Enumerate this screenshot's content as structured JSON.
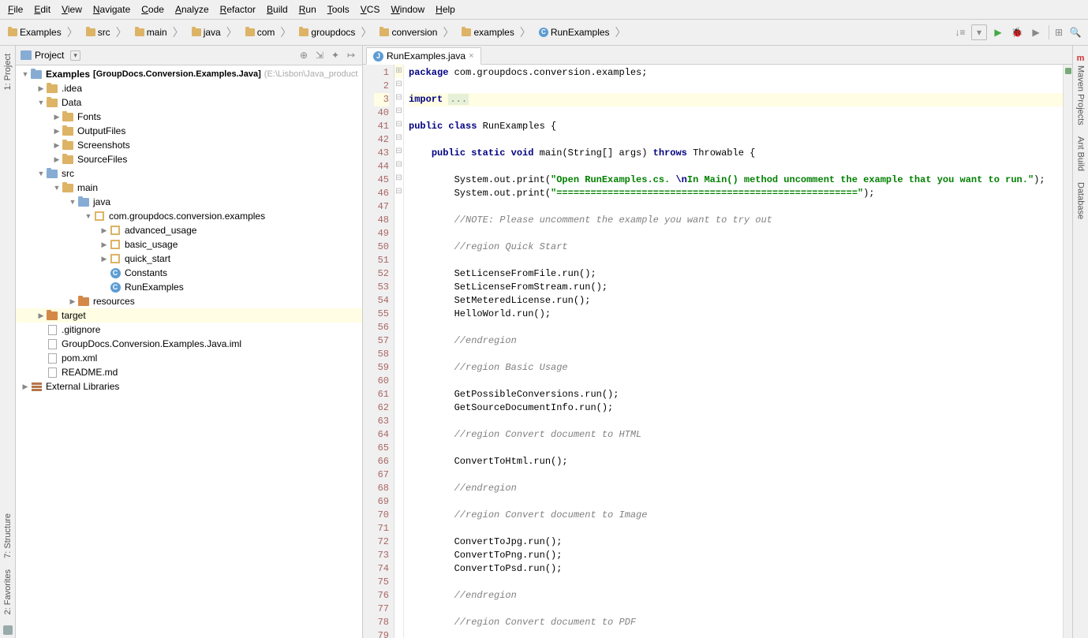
{
  "menu": [
    "File",
    "Edit",
    "View",
    "Navigate",
    "Code",
    "Analyze",
    "Refactor",
    "Build",
    "Run",
    "Tools",
    "VCS",
    "Window",
    "Help"
  ],
  "breadcrumbs": [
    {
      "icon": "folder",
      "label": "Examples"
    },
    {
      "icon": "folder",
      "label": "src"
    },
    {
      "icon": "folder",
      "label": "main"
    },
    {
      "icon": "folder",
      "label": "java"
    },
    {
      "icon": "folder",
      "label": "com"
    },
    {
      "icon": "folder",
      "label": "groupdocs"
    },
    {
      "icon": "folder",
      "label": "conversion"
    },
    {
      "icon": "folder",
      "label": "examples"
    },
    {
      "icon": "class",
      "label": "RunExamples"
    }
  ],
  "left_rail": [
    {
      "label": "1: Project"
    }
  ],
  "right_rail": [
    {
      "label": "Maven Projects",
      "icon": "m"
    },
    {
      "label": "Ant Build",
      "icon": "ant"
    },
    {
      "label": "Database",
      "icon": "db"
    }
  ],
  "bottom_left_rail": [
    {
      "label": "7: Structure"
    },
    {
      "label": "2: Favorites"
    }
  ],
  "panel": {
    "title": "Project",
    "buttons": [
      "target",
      "autoscroll",
      "collapse",
      "settings",
      "hide"
    ]
  },
  "tree": [
    {
      "d": 0,
      "t": "v",
      "i": "mod",
      "l": "Examples",
      "bold": true,
      "hint": "[GroupDocs.Conversion.Examples.Java]",
      "hint2": "(E:\\Lisbon\\Java_product"
    },
    {
      "d": 1,
      "t": ">",
      "i": "fld",
      "l": ".idea"
    },
    {
      "d": 1,
      "t": "v",
      "i": "fld",
      "l": "Data"
    },
    {
      "d": 2,
      "t": ">",
      "i": "fld",
      "l": "Fonts"
    },
    {
      "d": 2,
      "t": ">",
      "i": "fld",
      "l": "OutputFiles"
    },
    {
      "d": 2,
      "t": ">",
      "i": "fld",
      "l": "Screenshots"
    },
    {
      "d": 2,
      "t": ">",
      "i": "fld",
      "l": "SourceFiles"
    },
    {
      "d": 1,
      "t": "v",
      "i": "fldb",
      "l": "src"
    },
    {
      "d": 2,
      "t": "v",
      "i": "fld",
      "l": "main"
    },
    {
      "d": 3,
      "t": "v",
      "i": "fldb",
      "l": "java"
    },
    {
      "d": 4,
      "t": "v",
      "i": "pkg",
      "l": "com.groupdocs.conversion.examples"
    },
    {
      "d": 5,
      "t": ">",
      "i": "pkg",
      "l": "advanced_usage"
    },
    {
      "d": 5,
      "t": ">",
      "i": "pkg",
      "l": "basic_usage"
    },
    {
      "d": 5,
      "t": ">",
      "i": "pkg",
      "l": "quick_start"
    },
    {
      "d": 5,
      "t": " ",
      "i": "cls",
      "l": "Constants"
    },
    {
      "d": 5,
      "t": " ",
      "i": "cls",
      "l": "RunExamples"
    },
    {
      "d": 3,
      "t": ">",
      "i": "fldo",
      "l": "resources"
    },
    {
      "d": 1,
      "t": ">",
      "i": "fldo",
      "l": "target",
      "sel": true
    },
    {
      "d": 1,
      "t": " ",
      "i": "file",
      "l": ".gitignore"
    },
    {
      "d": 1,
      "t": " ",
      "i": "file",
      "l": "GroupDocs.Conversion.Examples.Java.iml"
    },
    {
      "d": 1,
      "t": " ",
      "i": "file",
      "l": "pom.xml"
    },
    {
      "d": 1,
      "t": " ",
      "i": "file",
      "l": "README.md"
    },
    {
      "d": 0,
      "t": ">",
      "i": "lib",
      "l": "External Libraries"
    }
  ],
  "tab": {
    "name": "RunExamples.java"
  },
  "code": {
    "lines": [
      {
        "n": 1,
        "f": "",
        "seg": [
          {
            "c": "kw",
            "t": "package "
          },
          {
            "c": "",
            "t": "com.groupdocs.conversion.examples;"
          }
        ]
      },
      {
        "n": 2,
        "f": "",
        "seg": []
      },
      {
        "n": 3,
        "f": "+",
        "hl": true,
        "seg": [
          {
            "c": "kw",
            "t": "import "
          },
          {
            "c": "fold-pl",
            "t": "..."
          }
        ]
      },
      {
        "n": 40,
        "f": "",
        "seg": []
      },
      {
        "n": 41,
        "f": "",
        "seg": [
          {
            "c": "kw",
            "t": "public class "
          },
          {
            "c": "",
            "t": "RunExamples {"
          }
        ]
      },
      {
        "n": 42,
        "f": "",
        "seg": []
      },
      {
        "n": 43,
        "f": "-",
        "seg": [
          {
            "c": "",
            "t": "    "
          },
          {
            "c": "kw",
            "t": "public static void "
          },
          {
            "c": "",
            "t": "main(String[] args) "
          },
          {
            "c": "kw",
            "t": "throws "
          },
          {
            "c": "",
            "t": "Throwable {"
          }
        ]
      },
      {
        "n": 44,
        "f": "",
        "seg": []
      },
      {
        "n": 45,
        "f": "",
        "seg": [
          {
            "c": "",
            "t": "        System.out.print("
          },
          {
            "c": "str",
            "t": "\"Open RunExamples.cs. "
          },
          {
            "c": "esc",
            "t": "\\n"
          },
          {
            "c": "str",
            "t": "In Main() method uncomment the example that you want to run.\""
          },
          {
            "c": "",
            "t": ");"
          }
        ]
      },
      {
        "n": 46,
        "f": "",
        "seg": [
          {
            "c": "",
            "t": "        System.out.print("
          },
          {
            "c": "str",
            "t": "\"=====================================================\""
          },
          {
            "c": "",
            "t": ");"
          }
        ]
      },
      {
        "n": 47,
        "f": "",
        "seg": []
      },
      {
        "n": 48,
        "f": "",
        "seg": [
          {
            "c": "",
            "t": "        "
          },
          {
            "c": "cmt",
            "t": "//NOTE: Please uncomment the example you want to try out"
          }
        ]
      },
      {
        "n": 49,
        "f": "",
        "seg": []
      },
      {
        "n": 50,
        "f": "-",
        "seg": [
          {
            "c": "",
            "t": "        "
          },
          {
            "c": "cmt",
            "t": "//region Quick Start"
          }
        ]
      },
      {
        "n": 51,
        "f": "",
        "seg": []
      },
      {
        "n": 52,
        "f": "",
        "seg": [
          {
            "c": "",
            "t": "        SetLicenseFromFile.run();"
          }
        ]
      },
      {
        "n": 53,
        "f": "",
        "seg": [
          {
            "c": "",
            "t": "        SetLicenseFromStream.run();"
          }
        ]
      },
      {
        "n": 54,
        "f": "",
        "seg": [
          {
            "c": "",
            "t": "        SetMeteredLicense.run();"
          }
        ]
      },
      {
        "n": 55,
        "f": "",
        "seg": [
          {
            "c": "",
            "t": "        HelloWorld.run();"
          }
        ]
      },
      {
        "n": 56,
        "f": "",
        "seg": []
      },
      {
        "n": 57,
        "f": "-",
        "seg": [
          {
            "c": "",
            "t": "        "
          },
          {
            "c": "cmt",
            "t": "//endregion"
          }
        ]
      },
      {
        "n": 58,
        "f": "",
        "seg": []
      },
      {
        "n": 59,
        "f": "-",
        "seg": [
          {
            "c": "",
            "t": "        "
          },
          {
            "c": "cmt",
            "t": "//region Basic Usage"
          }
        ]
      },
      {
        "n": 60,
        "f": "",
        "seg": []
      },
      {
        "n": 61,
        "f": "",
        "seg": [
          {
            "c": "",
            "t": "        GetPossibleConversions.run();"
          }
        ]
      },
      {
        "n": 62,
        "f": "",
        "seg": [
          {
            "c": "",
            "t": "        GetSourceDocumentInfo.run();"
          }
        ]
      },
      {
        "n": 63,
        "f": "",
        "seg": []
      },
      {
        "n": 64,
        "f": "-",
        "seg": [
          {
            "c": "",
            "t": "        "
          },
          {
            "c": "cmt",
            "t": "//region Convert document to HTML"
          }
        ]
      },
      {
        "n": 65,
        "f": "",
        "seg": []
      },
      {
        "n": 66,
        "f": "",
        "seg": [
          {
            "c": "",
            "t": "        ConvertToHtml.run();"
          }
        ]
      },
      {
        "n": 67,
        "f": "",
        "seg": []
      },
      {
        "n": 68,
        "f": "-",
        "seg": [
          {
            "c": "",
            "t": "        "
          },
          {
            "c": "cmt",
            "t": "//endregion"
          }
        ]
      },
      {
        "n": 69,
        "f": "",
        "seg": []
      },
      {
        "n": 70,
        "f": "-",
        "seg": [
          {
            "c": "",
            "t": "        "
          },
          {
            "c": "cmt",
            "t": "//region Convert document to Image"
          }
        ]
      },
      {
        "n": 71,
        "f": "",
        "seg": []
      },
      {
        "n": 72,
        "f": "",
        "seg": [
          {
            "c": "",
            "t": "        ConvertToJpg.run();"
          }
        ]
      },
      {
        "n": 73,
        "f": "",
        "seg": [
          {
            "c": "",
            "t": "        ConvertToPng.run();"
          }
        ]
      },
      {
        "n": 74,
        "f": "",
        "seg": [
          {
            "c": "",
            "t": "        ConvertToPsd.run();"
          }
        ]
      },
      {
        "n": 75,
        "f": "",
        "seg": []
      },
      {
        "n": 76,
        "f": "-",
        "seg": [
          {
            "c": "",
            "t": "        "
          },
          {
            "c": "cmt",
            "t": "//endregion"
          }
        ]
      },
      {
        "n": 77,
        "f": "",
        "seg": []
      },
      {
        "n": 78,
        "f": "-",
        "seg": [
          {
            "c": "",
            "t": "        "
          },
          {
            "c": "cmt",
            "t": "//region Convert document to PDF"
          }
        ]
      },
      {
        "n": 79,
        "f": "",
        "seg": []
      }
    ]
  }
}
